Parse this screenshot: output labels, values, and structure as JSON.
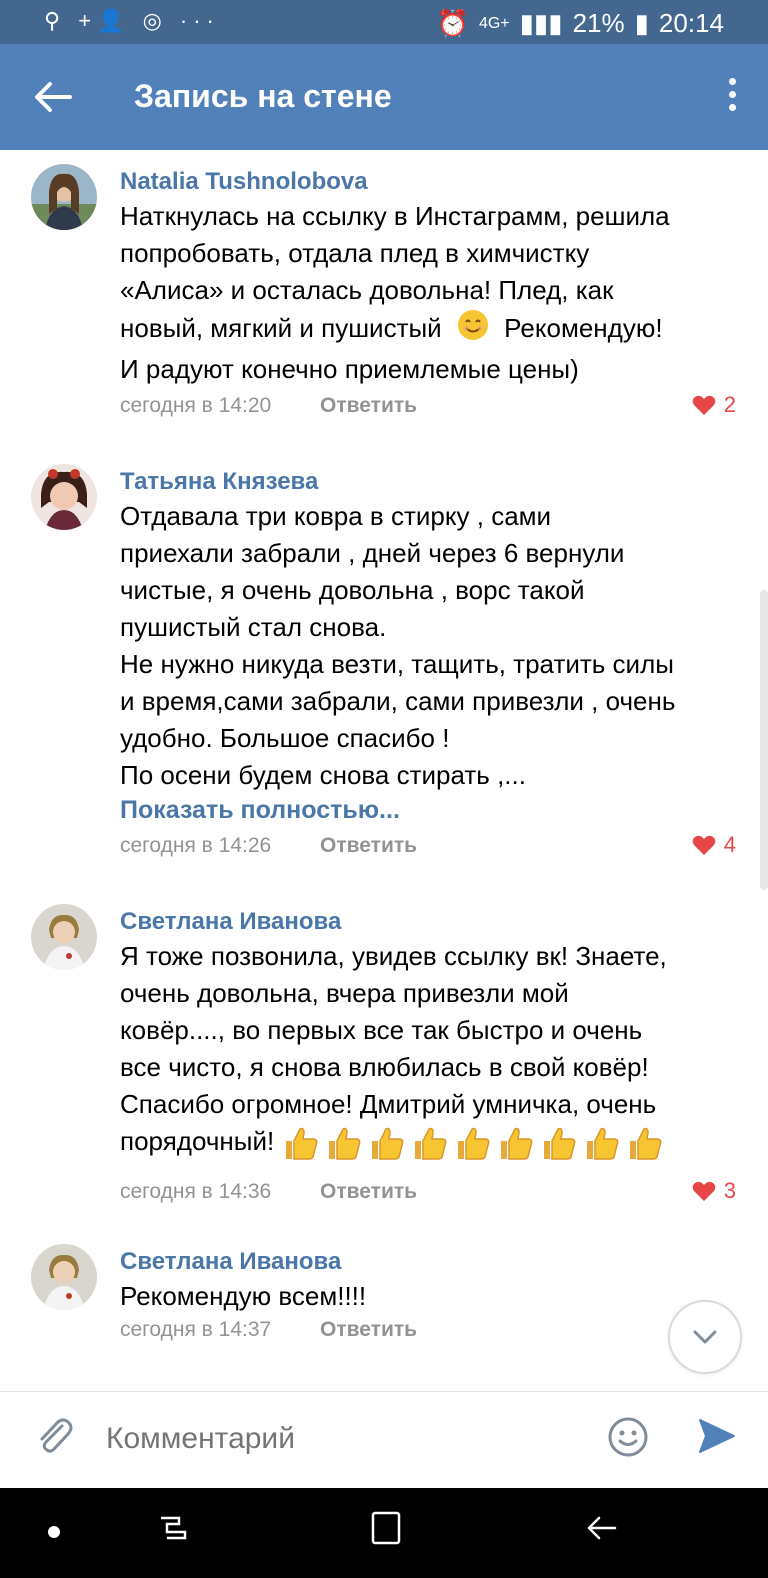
{
  "status_bar": {
    "left_icons": "⚲ +👤 ◎ ···",
    "network": "4G+",
    "battery": "21%",
    "time": "20:14"
  },
  "header": {
    "title": "Запись на стене"
  },
  "comments": [
    {
      "author": "Natalia Tushnolobova",
      "lines": [
        "Наткнулась на ссылку в Инстаграмм, решила",
        "попробовать, отдала плед в химчистку",
        "«Алиса» и осталась довольна! Плед, как",
        "новый, мягкий и пушистый",
        "Рекомендую!",
        "И радуют конечно приемлемые цены)"
      ],
      "time": "сегодня в 14:20",
      "reply": "Ответить",
      "likes": "2"
    },
    {
      "author": "Татьяна Князева",
      "lines": [
        "Отдавала три ковра в стирку , сами",
        "приехали забрали , дней через 6 вернули",
        "чистые, я очень довольна , ворс такой",
        "пушистый стал снова.",
        "Не нужно никуда везти, тащить, тратить силы",
        "и время,сами забрали, сами привезли , очень",
        "удобно. Большое спасибо !",
        "По осени будем снова стирать ,..."
      ],
      "more": "Показать полностью...",
      "time": "сегодня в 14:26",
      "reply": "Ответить",
      "likes": "4"
    },
    {
      "author": "Светлана Иванова",
      "lines": [
        "Я тоже позвонила, увидев ссылку вк! Знаете,",
        "очень довольна, вчера привезли мой",
        "ковёр...., во первых все так быстро и очень",
        "все чисто, я снова влюбилась в свой ковёр!",
        "Спасибо огромное! Дмитрий умничка, очень",
        "порядочный!"
      ],
      "thumbs_count": 9,
      "time": "сегодня в 14:36",
      "reply": "Ответить",
      "likes": "3"
    },
    {
      "author": "Светлана Иванова",
      "lines": [
        "Рекомендую всем!!!!"
      ],
      "time": "сегодня в 14:37",
      "reply": "Ответить"
    }
  ],
  "composer": {
    "placeholder": "Комментарий"
  },
  "colors": {
    "appbar": "#5181b8",
    "statusbar": "#43678f",
    "link": "#4a76a8",
    "like": "#e64646",
    "meta": "#939393"
  }
}
